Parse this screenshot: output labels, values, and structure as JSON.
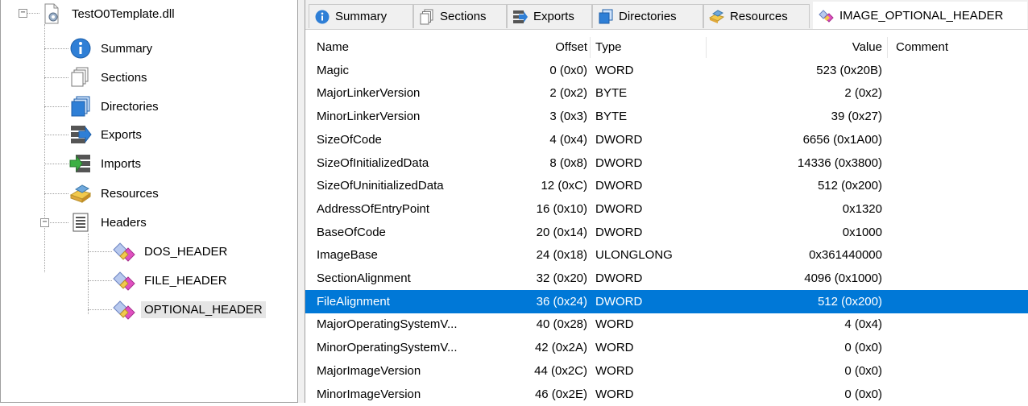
{
  "tree": {
    "root": "TestO0Template.dll",
    "items": [
      "Summary",
      "Sections",
      "Directories",
      "Exports",
      "Imports",
      "Resources",
      "Headers"
    ],
    "headers_children": [
      "DOS_HEADER",
      "FILE_HEADER",
      "OPTIONAL_HEADER"
    ],
    "selected": "OPTIONAL_HEADER"
  },
  "tabs": [
    {
      "label": "Summary",
      "icon": "info-icon"
    },
    {
      "label": "Sections",
      "icon": "sections-icon"
    },
    {
      "label": "Exports",
      "icon": "exports-icon"
    },
    {
      "label": "Directories",
      "icon": "directories-icon"
    },
    {
      "label": "Resources",
      "icon": "resources-icon"
    },
    {
      "label": "IMAGE_OPTIONAL_HEADER",
      "icon": "header-icon",
      "active": true
    }
  ],
  "grid": {
    "columns": {
      "name": "Name",
      "offset": "Offset",
      "type": "Type",
      "value": "Value",
      "comment": "Comment"
    },
    "selected_row": 10,
    "rows": [
      {
        "name": "Magic",
        "offset": "0 (0x0)",
        "type": "WORD",
        "value": "523 (0x20B)"
      },
      {
        "name": "MajorLinkerVersion",
        "offset": "2 (0x2)",
        "type": "BYTE",
        "value": "2 (0x2)"
      },
      {
        "name": "MinorLinkerVersion",
        "offset": "3 (0x3)",
        "type": "BYTE",
        "value": "39 (0x27)"
      },
      {
        "name": "SizeOfCode",
        "offset": "4 (0x4)",
        "type": "DWORD",
        "value": "6656 (0x1A00)"
      },
      {
        "name": "SizeOfInitializedData",
        "offset": "8 (0x8)",
        "type": "DWORD",
        "value": "14336 (0x3800)"
      },
      {
        "name": "SizeOfUninitializedData",
        "offset": "12 (0xC)",
        "type": "DWORD",
        "value": "512 (0x200)"
      },
      {
        "name": "AddressOfEntryPoint",
        "offset": "16 (0x10)",
        "type": "DWORD",
        "value": "0x1320"
      },
      {
        "name": "BaseOfCode",
        "offset": "20 (0x14)",
        "type": "DWORD",
        "value": "0x1000"
      },
      {
        "name": "ImageBase",
        "offset": "24 (0x18)",
        "type": "ULONGLONG",
        "value": "0x361440000"
      },
      {
        "name": "SectionAlignment",
        "offset": "32 (0x20)",
        "type": "DWORD",
        "value": "4096 (0x1000)"
      },
      {
        "name": "FileAlignment",
        "offset": "36 (0x24)",
        "type": "DWORD",
        "value": "512 (0x200)"
      },
      {
        "name": "MajorOperatingSystemV...",
        "offset": "40 (0x28)",
        "type": "WORD",
        "value": "4 (0x4)"
      },
      {
        "name": "MinorOperatingSystemV...",
        "offset": "42 (0x2A)",
        "type": "WORD",
        "value": "0 (0x0)"
      },
      {
        "name": "MajorImageVersion",
        "offset": "44 (0x2C)",
        "type": "WORD",
        "value": "0 (0x0)"
      },
      {
        "name": "MinorImageVersion",
        "offset": "46 (0x2E)",
        "type": "WORD",
        "value": "0 (0x0)"
      }
    ]
  },
  "colors": {
    "selection": "#0078d7",
    "tree_selection": "#e5e5e5"
  }
}
